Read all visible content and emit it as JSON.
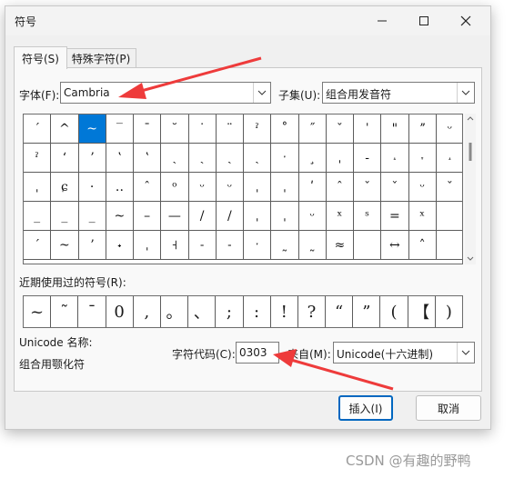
{
  "window": {
    "title": "符号"
  },
  "tabs": [
    {
      "label": "符号(S)"
    },
    {
      "label": "特殊字符(P)"
    }
  ],
  "font": {
    "label": "字体(F):",
    "value": "Cambria"
  },
  "subset": {
    "label": "子集(U):",
    "value": "组合用发音符"
  },
  "grid": {
    "selected_index": 2,
    "cells": [
      "ˊ",
      "^",
      "~",
      "‾",
      "¯",
      "˘",
      "˙",
      "¨",
      "ˀ",
      "˚",
      "˝",
      "ˇ",
      "ˈ",
      "\"",
      "ˮ",
      "ᵕ",
      "ˀ",
      "ʻ",
      "ʼ",
      "ʽ",
      "ʽ",
      "ˏ",
      "ˏ",
      "ˎ",
      "ˏ",
      "ˑ",
      "¸",
      "ˌ",
      "‐",
      "˔",
      "˕",
      "˔",
      "ˌ",
      "ɕ",
      "·",
      "‥",
      "ˆ",
      "ᵒ",
      "ᵕ",
      "ᵕ",
      "ˌ",
      "ˌ",
      "ʹ",
      "ˆ",
      "ˇ",
      "ˇ",
      "ᵕ",
      "ˇ",
      "_",
      "_",
      "_",
      "~",
      "–",
      "—",
      "/",
      "/",
      "ˌ",
      "ˌ",
      "ᵕ",
      "ˣ",
      "ˢ",
      "=",
      "ˣ",
      "",
      "ˊ",
      "~",
      "ʼ",
      "˖",
      "ˌ",
      "˧",
      "˗",
      "˗",
      "ˑ",
      "˷",
      "˷",
      "≈",
      "",
      "↔",
      "˄",
      ""
    ]
  },
  "recent": {
    "label": "近期使用过的符号(R):",
    "symbols": [
      "~",
      "˜",
      "¯",
      "0",
      ",",
      "。",
      "、",
      ";",
      ":",
      "!",
      "?",
      "“",
      "”",
      "(",
      "【",
      ")"
    ]
  },
  "unicode_name": {
    "label": "Unicode 名称:",
    "value": "组合用颚化符"
  },
  "char_code": {
    "label": "字符代码(C):",
    "value": "0303"
  },
  "from": {
    "label": "来自(M):",
    "value": "Unicode(十六进制)"
  },
  "buttons": {
    "insert": "插入(I)",
    "cancel": "取消"
  },
  "watermark": "CSDN @有趣的野鸭",
  "colors": {
    "selection": "#0078d7",
    "annotation_arrow": "#ee3b3b",
    "primary_border": "#0067c0"
  }
}
